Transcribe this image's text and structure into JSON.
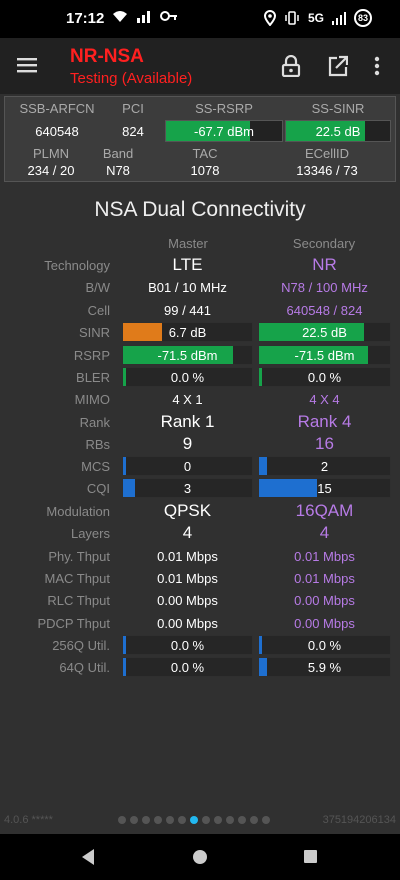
{
  "status_bar": {
    "time": "17:12",
    "network": "5G",
    "battery": "83"
  },
  "toolbar": {
    "title": "NR-NSA",
    "subtitle": "Testing (Available)"
  },
  "info": {
    "headers1": [
      "SSB-ARFCN",
      "PCI",
      "SS-RSRP",
      "SS-SINR"
    ],
    "values1": {
      "ssb_arfcn": "640548",
      "pci": "824",
      "ss_rsrp": "-67.7 dBm",
      "ss_sinr": "22.5 dB"
    },
    "ss_rsrp_level": 0.72,
    "ss_sinr_level": 0.76,
    "headers2": [
      "PLMN",
      "Band",
      "TAC",
      "ECellID"
    ],
    "values2": {
      "plmn": "234 / 20",
      "band": "N78",
      "tac": "1078",
      "ecellid": "13346 / 73"
    }
  },
  "section_title": "NSA Dual Connectivity",
  "columns": {
    "master": "Master",
    "secondary": "Secondary"
  },
  "rows": {
    "technology": {
      "label": "Technology",
      "master": "LTE",
      "secondary": "NR"
    },
    "bw": {
      "label": "B/W",
      "master": "B01 / 10 MHz",
      "secondary": "N78 / 100 MHz"
    },
    "cell": {
      "label": "Cell",
      "master": "99 / 441",
      "secondary": "640548 / 824"
    },
    "sinr": {
      "label": "SINR",
      "master": "6.7 dB",
      "secondary": "22.5 dB",
      "master_level": 0.3,
      "secondary_level": 0.8
    },
    "rsrp": {
      "label": "RSRP",
      "master": "-71.5 dBm",
      "secondary": "-71.5 dBm",
      "master_level": 0.85,
      "secondary_level": 0.83
    },
    "bler": {
      "label": "BLER",
      "master": "0.0 %",
      "secondary": "0.0 %",
      "master_level": 0.02,
      "secondary_level": 0.02
    },
    "mimo": {
      "label": "MIMO",
      "master": "4 X 1",
      "secondary": "4 X 4"
    },
    "rank": {
      "label": "Rank",
      "master": "Rank 1",
      "secondary": "Rank 4"
    },
    "rbs": {
      "label": "RBs",
      "master": "9",
      "secondary": "16"
    },
    "mcs": {
      "label": "MCS",
      "master": "0",
      "secondary": "2",
      "master_level": 0.02,
      "secondary_level": 0.06
    },
    "cqi": {
      "label": "CQI",
      "master": "3",
      "secondary": "15",
      "master_level": 0.09,
      "secondary_level": 0.44
    },
    "modulation": {
      "label": "Modulation",
      "master": "QPSK",
      "secondary": "16QAM"
    },
    "layers": {
      "label": "Layers",
      "master": "4",
      "secondary": "4"
    },
    "phy_thput": {
      "label": "Phy. Thput",
      "master": "0.01 Mbps",
      "secondary": "0.01 Mbps"
    },
    "mac_thput": {
      "label": "MAC Thput",
      "master": "0.01 Mbps",
      "secondary": "0.01 Mbps"
    },
    "rlc_thput": {
      "label": "RLC Thput",
      "master": "0.00 Mbps",
      "secondary": "0.00 Mbps"
    },
    "pdcp_thput": {
      "label": "PDCP Thput",
      "master": "0.00 Mbps",
      "secondary": "0.00 Mbps"
    },
    "q256": {
      "label": "256Q Util.",
      "master": "0.0 %",
      "secondary": "0.0 %",
      "master_level": 0.02,
      "secondary_level": 0.02
    },
    "q64": {
      "label": "64Q Util.",
      "master": "0.0 %",
      "secondary": "5.9 %",
      "master_level": 0.02,
      "secondary_level": 0.06
    }
  },
  "colors": {
    "green": "#16a34a",
    "orange": "#e07b1a",
    "blue": "#1e6fd0",
    "purple": "#b77be6",
    "red": "#ff2020",
    "accent": "#22b8f0"
  },
  "footer": {
    "version": "4.0.6 *****",
    "id": "375194206134"
  },
  "page_dots": {
    "count": 13,
    "active": 6
  }
}
